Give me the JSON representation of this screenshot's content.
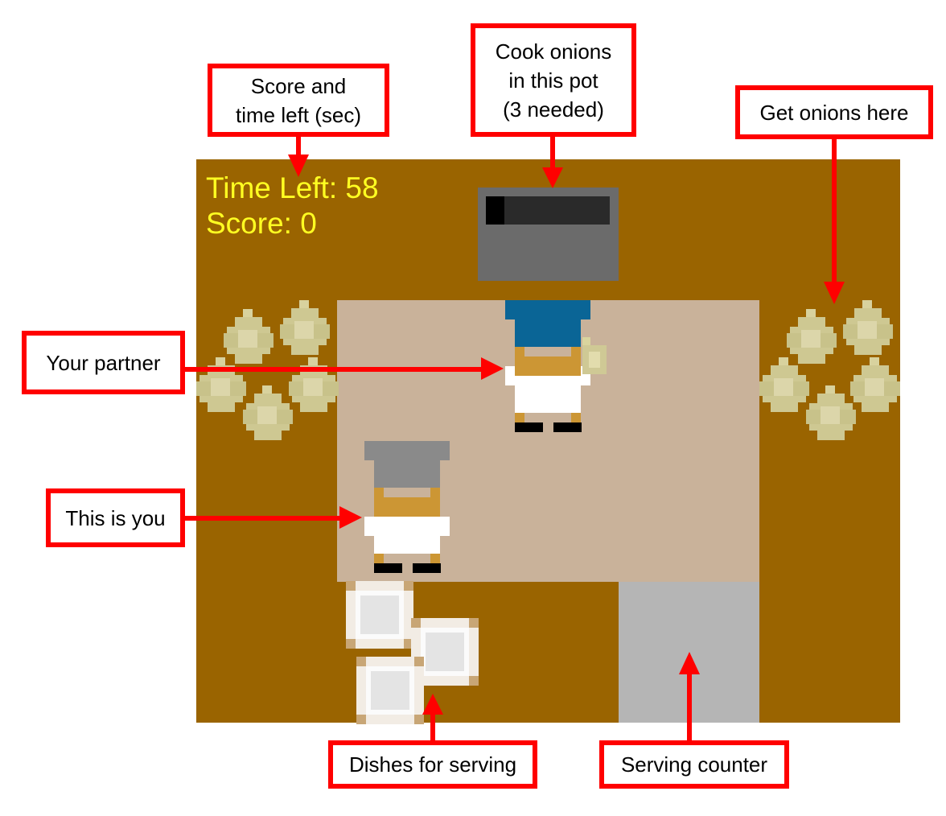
{
  "hud": {
    "time_left": "Time Left: 58",
    "score": "Score: 0"
  },
  "pot": {
    "cook_progress": 0.15
  },
  "annotations": {
    "score_time": [
      "Score and",
      "time left (sec)"
    ],
    "pot": [
      "Cook onions",
      "in this pot",
      "(3 needed)"
    ],
    "onions": "Get onions here",
    "partner": "Your partner",
    "you": "This is you",
    "dishes": "Dishes for serving",
    "serving": "Serving counter"
  },
  "colors": {
    "wall": "#9a6400",
    "floor": "#c9b29a",
    "serving_counter": "#b5b5b5",
    "hud_text": "#ffff22",
    "annotation_red": "#ff0000",
    "partner_hat": "#0a6596",
    "you_hat": "#8a8a8a"
  },
  "icons": {
    "onion": "onion-icon",
    "dish": "dish-icon",
    "pot": "cooking-pot-icon",
    "chef": "chef-icon"
  }
}
